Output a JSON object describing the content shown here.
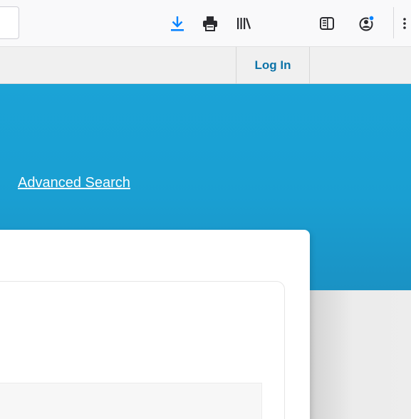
{
  "toolbar": {
    "icons": [
      "download-icon",
      "print-icon",
      "library-icon",
      "sidebar-icon",
      "account-icon",
      "menu-icon"
    ],
    "accent_color": "#0a84ff"
  },
  "site_nav": {
    "login_label": "Log In"
  },
  "hero": {
    "advanced_search_label": "Advanced Search",
    "background_color": "#1aa0d3"
  }
}
